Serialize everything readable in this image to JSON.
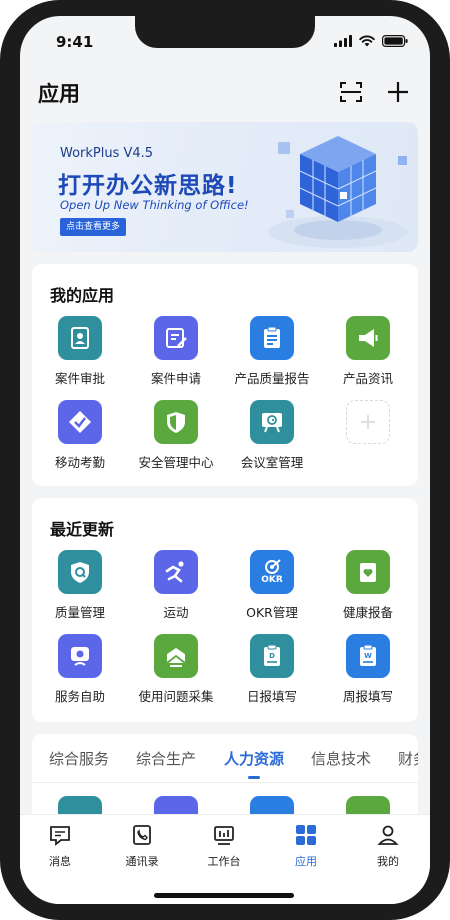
{
  "status_bar": {
    "time": "9:41"
  },
  "header": {
    "title": "应用"
  },
  "banner": {
    "product": "WorkPlus V4.5",
    "headline": "打开办公新思路!",
    "subtitle": "Open Up New Thinking of Office!",
    "button": "点击查看更多"
  },
  "my_apps": {
    "title": "我的应用",
    "items": [
      {
        "label": "案件审批",
        "icon": "contact-card-icon",
        "color": "#2f8f9d"
      },
      {
        "label": "案件申请",
        "icon": "edit-form-icon",
        "color": "#5b66e8"
      },
      {
        "label": "产品质量报告",
        "icon": "clipboard-list-icon",
        "color": "#2a7de1"
      },
      {
        "label": "产品资讯",
        "icon": "megaphone-icon",
        "color": "#5aa83e"
      },
      {
        "label": "移动考勤",
        "icon": "check-badge-icon",
        "color": "#5b66e8"
      },
      {
        "label": "安全管理中心",
        "icon": "shield-icon",
        "color": "#5aa83e"
      },
      {
        "label": "会议室管理",
        "icon": "meeting-board-icon",
        "color": "#2f8f9d"
      }
    ]
  },
  "recent": {
    "title": "最近更新",
    "items": [
      {
        "label": "质量管理",
        "icon": "quality-shield-icon",
        "color": "#2f8f9d"
      },
      {
        "label": "运动",
        "icon": "runner-icon",
        "color": "#5b66e8"
      },
      {
        "label": "OKR管理",
        "icon": "okr-target-icon",
        "color": "#2a7de1",
        "badge": "OKR"
      },
      {
        "label": "健康报备",
        "icon": "health-report-icon",
        "color": "#5aa83e"
      },
      {
        "label": "服务自助",
        "icon": "headset-icon",
        "color": "#5b66e8"
      },
      {
        "label": "使用问题采集",
        "icon": "feedback-collect-icon",
        "color": "#5aa83e"
      },
      {
        "label": "日报填写",
        "icon": "daily-report-icon",
        "color": "#2f8f9d",
        "badge": "D"
      },
      {
        "label": "周报填写",
        "icon": "weekly-report-icon",
        "color": "#2a7de1",
        "badge": "W"
      }
    ]
  },
  "category_tabs": {
    "items": [
      "综合服务",
      "综合生产",
      "人力资源",
      "信息技术",
      "财务"
    ],
    "active": "人力资源"
  },
  "bottom_nav": {
    "items": [
      {
        "label": "消息",
        "icon": "message-icon"
      },
      {
        "label": "通讯录",
        "icon": "contacts-icon"
      },
      {
        "label": "工作台",
        "icon": "workbench-icon"
      },
      {
        "label": "应用",
        "icon": "apps-grid-icon"
      },
      {
        "label": "我的",
        "icon": "profile-icon"
      }
    ],
    "active": "应用"
  },
  "colors": {
    "accent": "#2a6bd7",
    "teal": "#2f8f9d",
    "indigo": "#5b66e8",
    "blue": "#2a7de1",
    "green": "#5aa83e"
  }
}
